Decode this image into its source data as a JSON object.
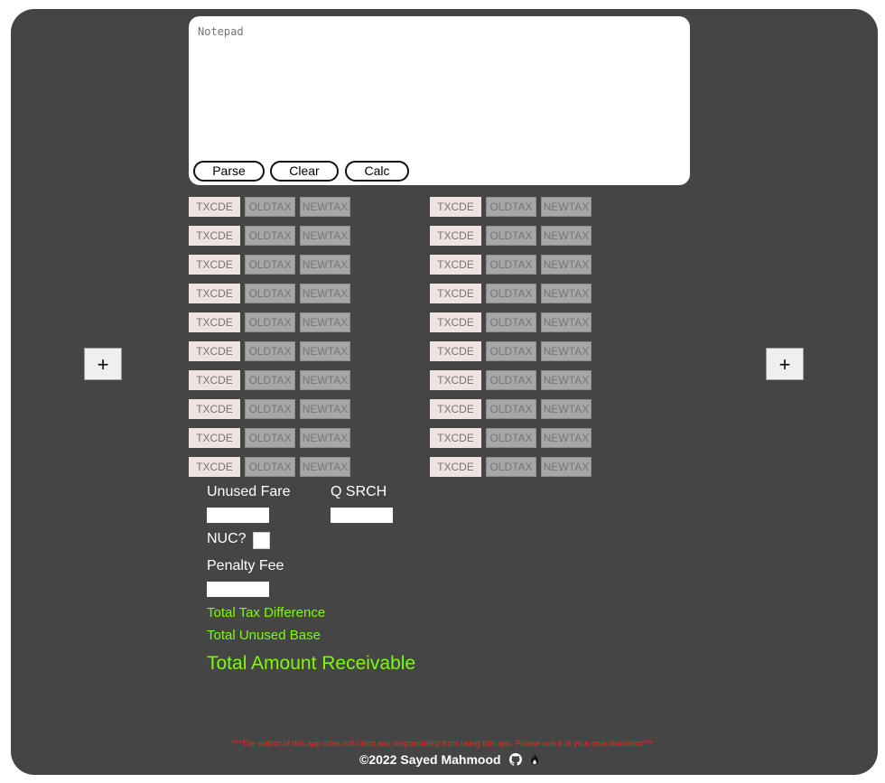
{
  "notepad": {
    "placeholder": "Notepad",
    "buttons": {
      "parse": "Parse",
      "clear": "Clear",
      "calc": "Calc"
    }
  },
  "tax_table": {
    "code_placeholder": "TXCDE",
    "old_placeholder": "OLDTAX",
    "new_placeholder": "NEWTAX",
    "rows_per_column": 10,
    "columns": 2
  },
  "add_buttons": {
    "left": "+",
    "right": "+"
  },
  "form": {
    "unused_fare_label": "Unused Fare",
    "unused_fare_value": "",
    "q_srch_label": "Q SRCH",
    "q_srch_value": "",
    "nuc_label": "NUC?",
    "nuc_checked": false,
    "penalty_fee_label": "Penalty Fee",
    "penalty_fee_value": ""
  },
  "totals": {
    "tax_difference_label": "Total Tax Difference",
    "unused_base_label": "Total Unused Base",
    "amount_receivable_label": "Total Amount Receivable"
  },
  "footer": {
    "disclaimer": "***The author of this app does not claim any responsibility from using this app. Please use it at your own discretion***",
    "copyright": "©2022 Sayed Mahmood",
    "icons": [
      "github-icon",
      "flame-icon"
    ]
  },
  "colors": {
    "background": "#454545",
    "accent_green": "#7cfc00",
    "disclaimer_red": "#ff2020"
  }
}
